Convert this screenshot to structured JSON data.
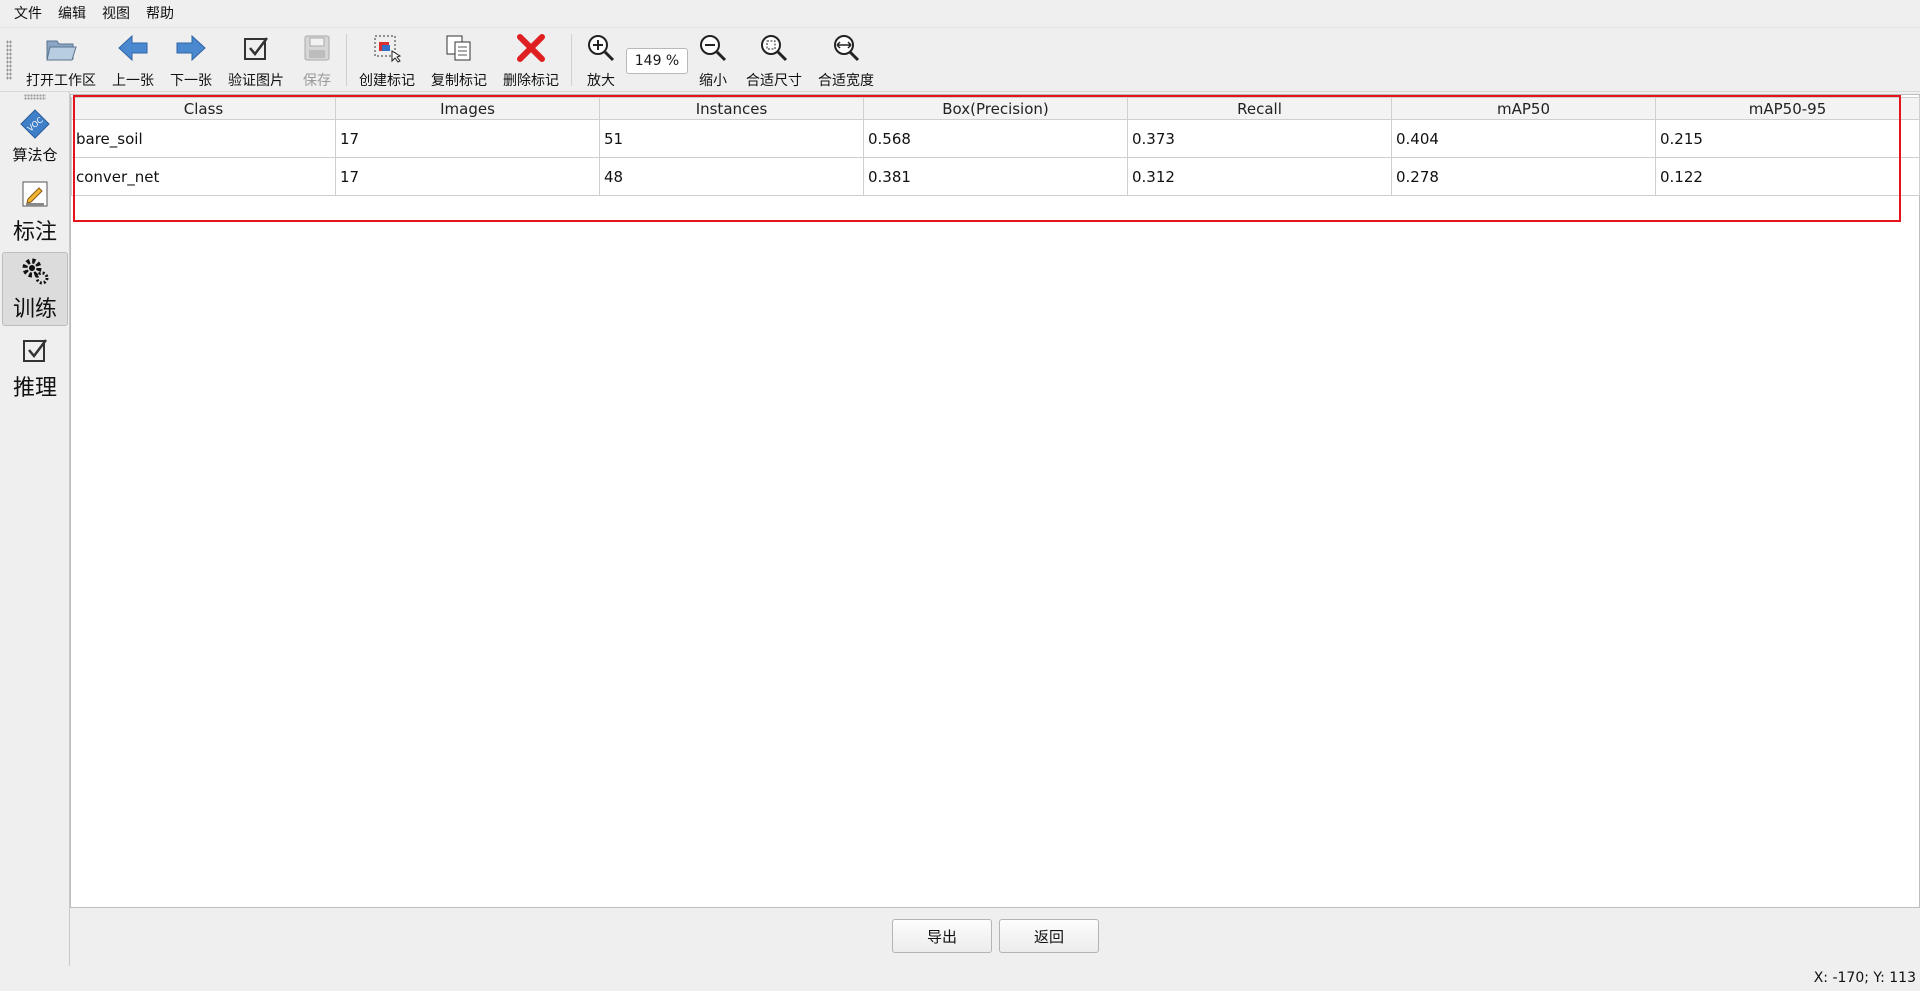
{
  "menu": [
    "文件",
    "编辑",
    "视图",
    "帮助"
  ],
  "toolbar": {
    "open_workspace": "打开工作区",
    "prev": "上一张",
    "next": "下一张",
    "verify": "验证图片",
    "save": "保存",
    "create_mark": "创建标记",
    "copy_mark": "复制标记",
    "delete_mark": "删除标记",
    "zoom_in": "放大",
    "zoom_value": "149 %",
    "zoom_out": "缩小",
    "fit_size": "合适尺寸",
    "fit_width": "合适宽度"
  },
  "sidebar": {
    "algo": "算法仓",
    "label": "标注",
    "train": "训练",
    "infer": "推理"
  },
  "table": {
    "headers": [
      "Class",
      "Images",
      "Instances",
      "Box(Precision)",
      "Recall",
      "mAP50",
      "mAP50-95"
    ],
    "rows": [
      [
        "bare_soil",
        "17",
        "51",
        "0.568",
        "0.373",
        "0.404",
        "0.215"
      ],
      [
        "conver_net",
        "17",
        "48",
        "0.381",
        "0.312",
        "0.278",
        "0.122"
      ]
    ]
  },
  "buttons": {
    "export": "导出",
    "back": "返回"
  },
  "status": {
    "coords": "X: -170; Y: 113"
  },
  "colors": {
    "highlight": "#e5141a",
    "accent_blue": "#3f7fc8",
    "delete_red": "#e02020"
  }
}
